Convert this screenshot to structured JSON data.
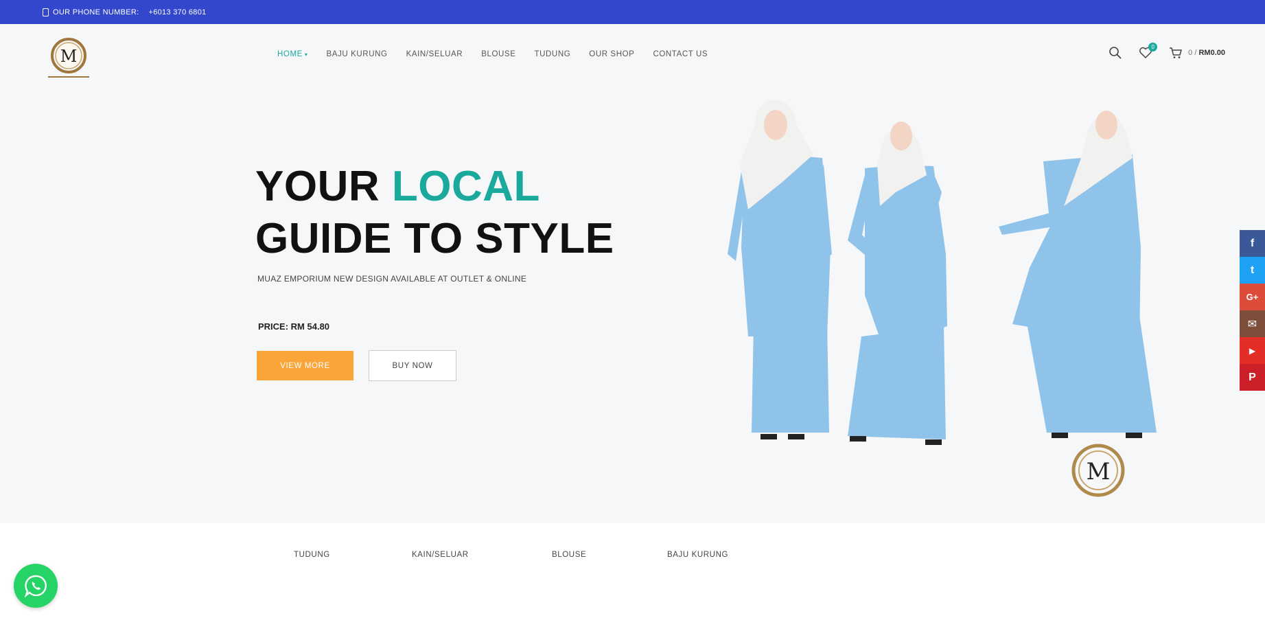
{
  "topbar": {
    "phone_label": "OUR PHONE NUMBER:",
    "phone_number": "+6013 370 6801"
  },
  "header": {
    "logo_letter": "M",
    "nav": [
      {
        "label": "HOME",
        "active": true
      },
      {
        "label": "BAJU KURUNG"
      },
      {
        "label": "KAIN/SELUAR"
      },
      {
        "label": "BLOUSE"
      },
      {
        "label": "TUDUNG"
      },
      {
        "label": "OUR SHOP"
      },
      {
        "label": "CONTACT US"
      }
    ],
    "wishlist_count": "0",
    "cart_count": "0",
    "cart_total": "RM0.00"
  },
  "hero": {
    "title_line1_a": "YOUR",
    "title_line1_b": "LOCAL",
    "title_line2": "GUIDE TO STYLE",
    "subtitle": "MUAZ EMPORIUM NEW DESIGN AVAILABLE AT OUTLET & ONLINE",
    "price": "PRICE: RM 54.80",
    "view_more": "VIEW MORE",
    "buy_now": "BUY NOW"
  },
  "categories": [
    "TUDUNG",
    "KAIN/SELUAR",
    "BLOUSE",
    "BAJU KURUNG"
  ],
  "social": [
    {
      "icon": "facebook-icon",
      "glyph": "f",
      "color": "#3b5998"
    },
    {
      "icon": "twitter-icon",
      "glyph": "t",
      "color": "#1da1f2"
    },
    {
      "icon": "google-plus-icon",
      "glyph": "G+",
      "color": "#dd4b39"
    },
    {
      "icon": "email-icon",
      "glyph": "✉",
      "color": "#7d4e3a"
    },
    {
      "icon": "youtube-icon",
      "glyph": "▶",
      "color": "#e52d27"
    },
    {
      "icon": "pinterest-icon",
      "glyph": "P",
      "color": "#cb2027"
    }
  ],
  "colors": {
    "brand_blue": "#3347cc",
    "accent_teal": "#1aa99c",
    "orange": "#f9a53a",
    "dress_blue": "#8fc3ea"
  }
}
